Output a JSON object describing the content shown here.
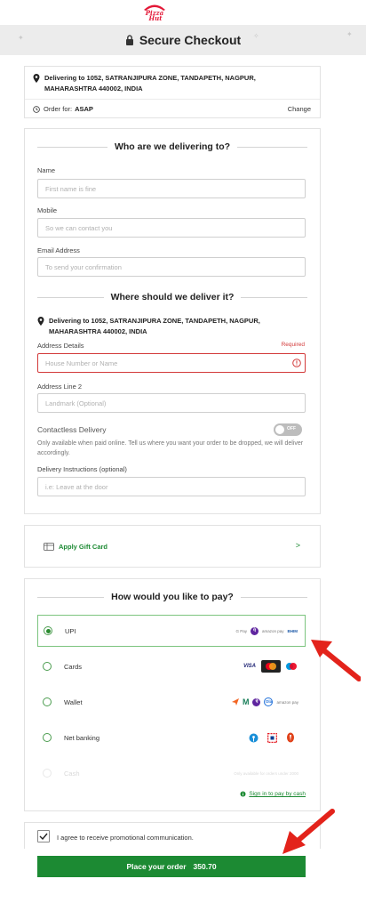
{
  "header": {
    "logo_text": "Pizza Hut",
    "title": "Secure Checkout"
  },
  "delivery_card": {
    "delivering_prefix": "Delivering",
    "delivering_to": "to 1052, SATRANJIPURA ZONE, TANDAPETH, NAGPUR, MAHARASHTRA 440002, INDIA",
    "order_for_label": "Order for:",
    "order_for_value": "ASAP",
    "change_label": "Change"
  },
  "contact": {
    "heading": "Who are we delivering to?",
    "name_label": "Name",
    "name_placeholder": "First name is fine",
    "mobile_label": "Mobile",
    "mobile_placeholder": "So we can contact you",
    "email_label": "Email Address",
    "email_placeholder": "To send your confirmation"
  },
  "address": {
    "heading": "Where should we deliver it?",
    "delivering_prefix": "Delivering",
    "delivering_to": "to 1052, SATRANJIPURA ZONE, TANDAPETH, NAGPUR, MAHARASHTRA 440002, INDIA",
    "details_label": "Address Details",
    "required_label": "Required",
    "details_placeholder": "House Number or Name",
    "line2_label": "Address Line 2",
    "line2_placeholder": "Landmark (Optional)",
    "contactless_label": "Contactless Delivery",
    "contactless_toggle": "OFF",
    "contactless_help": "Only available when paid online. Tell us where you want your order to be dropped, we will deliver accordingly.",
    "instructions_label": "Delivery Instructions (optional)",
    "instructions_placeholder": "i.e: Leave at the door"
  },
  "gift_card": {
    "label": "Apply Gift Card",
    "chevron": ">"
  },
  "payment": {
    "heading": "How would you like to pay?",
    "options": [
      {
        "label": "UPI",
        "selected": true,
        "icons": [
          "G Pay",
          "PhonePe",
          "amazon pay",
          "BHIM"
        ]
      },
      {
        "label": "Cards",
        "selected": false,
        "icons": [
          "VISA",
          "Mastercard",
          "Maestro"
        ]
      },
      {
        "label": "Wallet",
        "selected": false,
        "icons": [
          "Freecharge",
          "Mobikwik",
          "PhonePe",
          "Ola Money",
          "amazon pay"
        ]
      },
      {
        "label": "Net banking",
        "selected": false,
        "icons": [
          "SBI",
          "HDFC",
          "ICICI"
        ]
      },
      {
        "label": "Cash",
        "selected": false,
        "disabled": true,
        "note": "Only available for orders under 2000"
      }
    ],
    "signin_link": "Sign in to pay by cash"
  },
  "consent": {
    "label": "I agree to receive promotional communication.",
    "checked": true
  },
  "place_order": {
    "label": "Place your order",
    "amount": "350.70"
  },
  "colors": {
    "brand_green": "#1c8a33",
    "error_red": "#d33a3a",
    "pizza_hut_red": "#e31837"
  }
}
